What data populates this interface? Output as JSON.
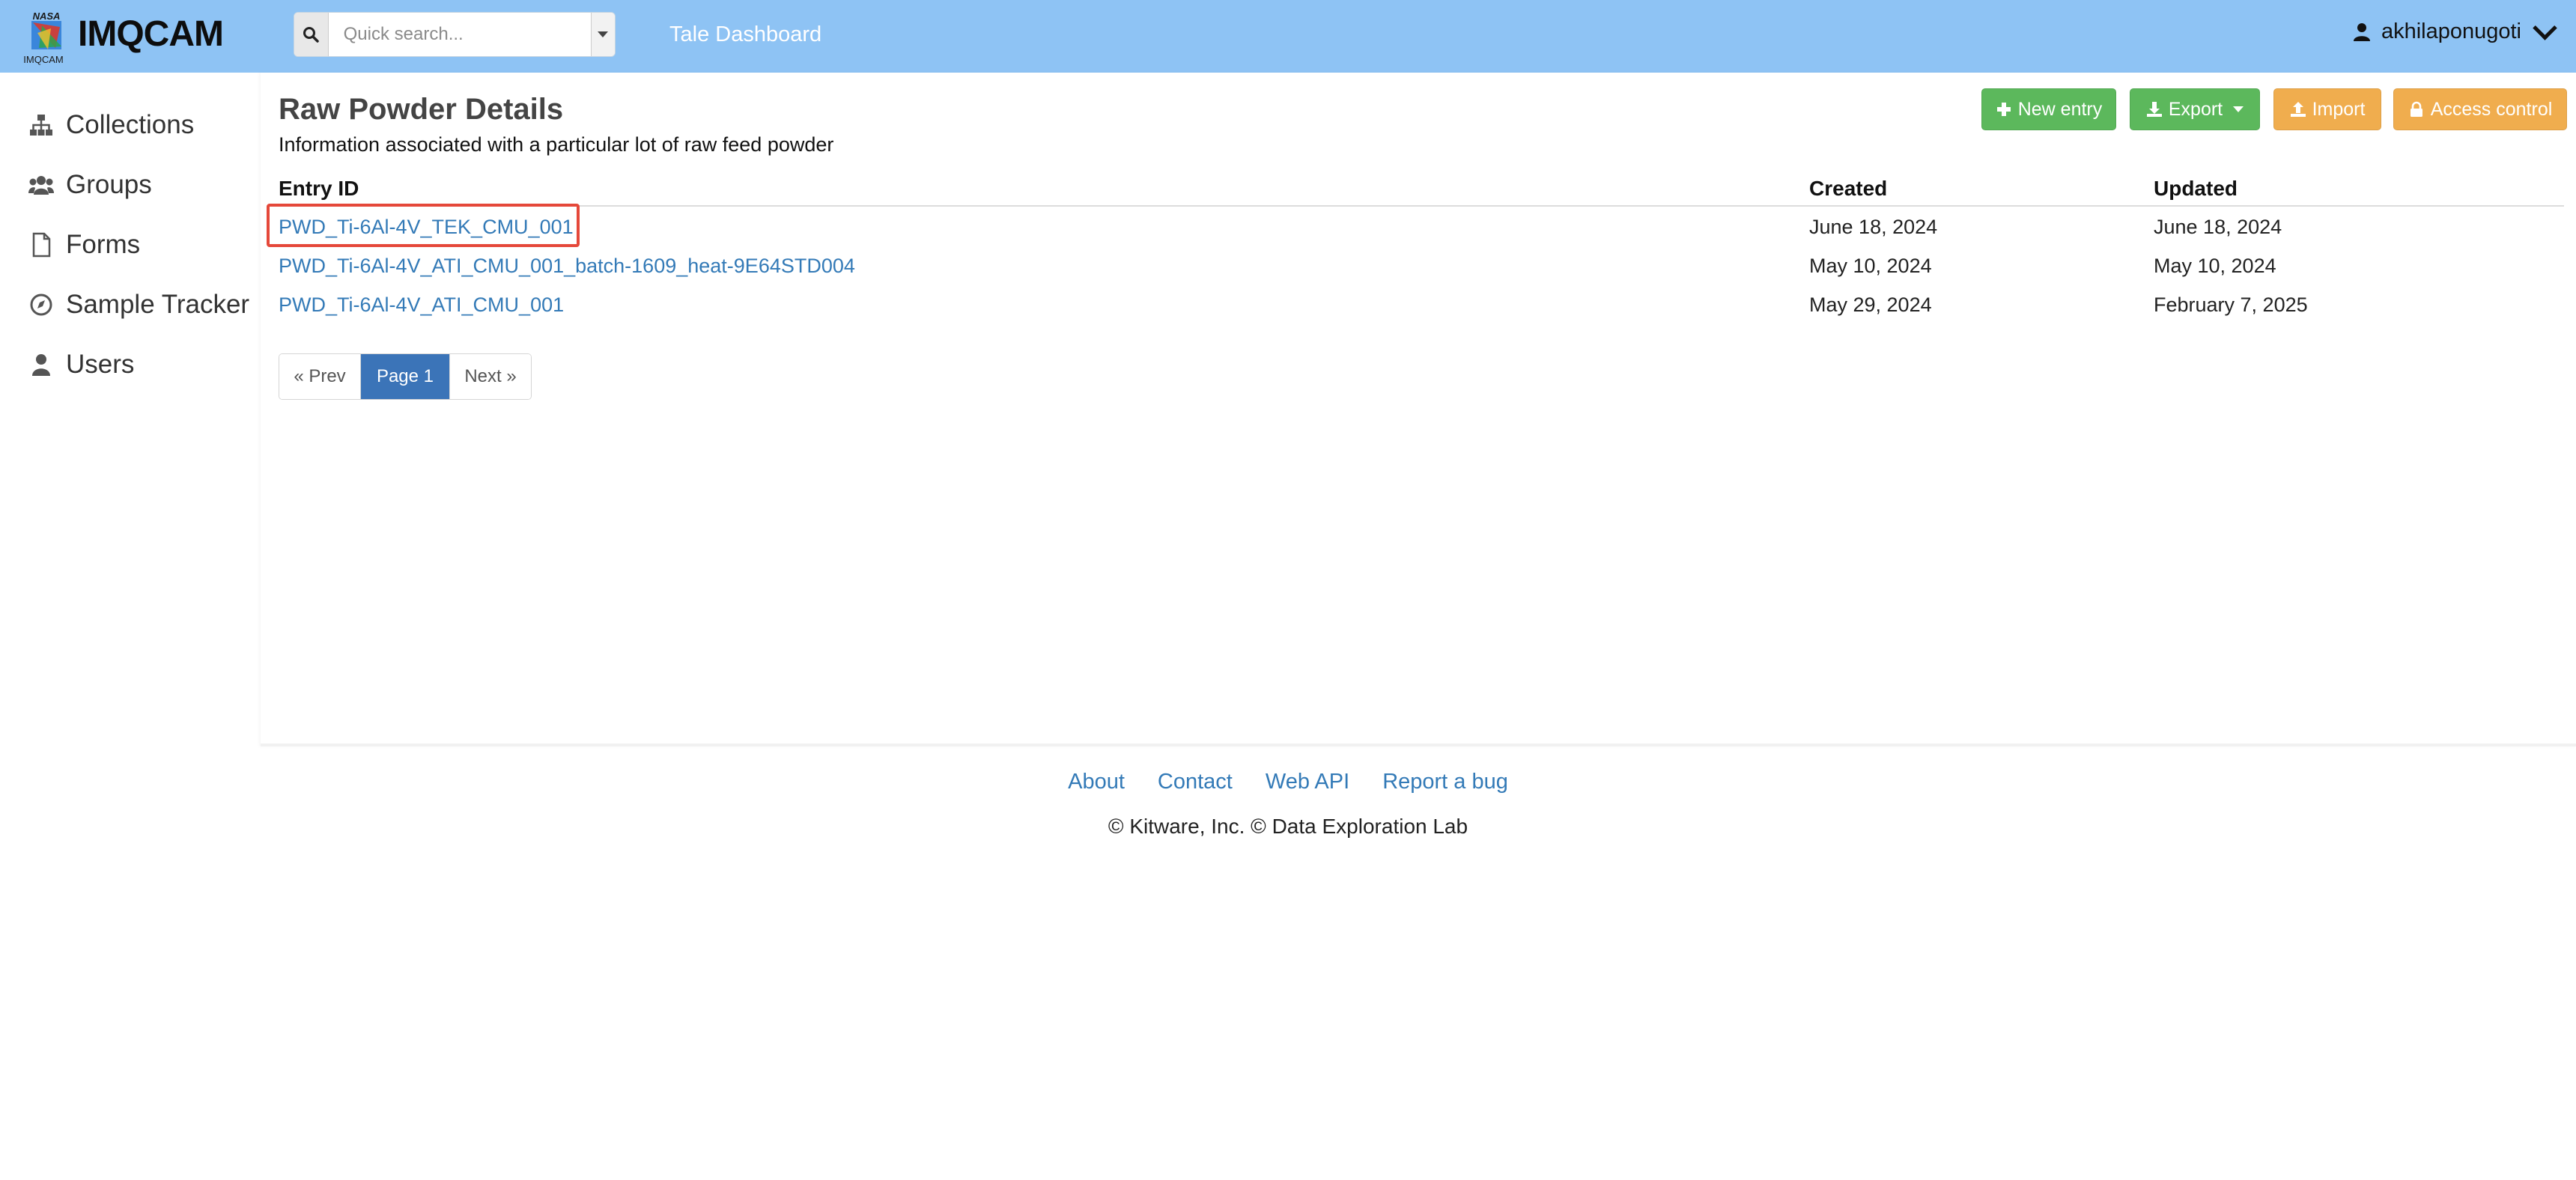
{
  "header": {
    "logo_top_text": "NASA",
    "logo_bottom_text": "IMQCAM",
    "brand": "IMQCAM",
    "search_placeholder": "Quick search...",
    "dashboard_link": "Tale Dashboard",
    "username": "akhilaponugoti"
  },
  "sidebar": {
    "items": [
      {
        "label": "Collections",
        "icon": "sitemap-icon"
      },
      {
        "label": "Groups",
        "icon": "users-icon"
      },
      {
        "label": "Forms",
        "icon": "file-icon"
      },
      {
        "label": "Sample Tracker",
        "icon": "compass-icon"
      },
      {
        "label": "Users",
        "icon": "user-icon"
      }
    ]
  },
  "main": {
    "title": "Raw Powder Details",
    "description": "Information associated with a particular lot of raw feed powder",
    "toolbar": {
      "new_entry": "New entry",
      "export": "Export",
      "import": "Import",
      "access_control": "Access control"
    },
    "table": {
      "headers": [
        "Entry ID",
        "Created",
        "Updated"
      ],
      "rows": [
        {
          "id": "PWD_Ti-6Al-4V_TEK_CMU_001",
          "created": "June 18, 2024",
          "updated": "June 18, 2024"
        },
        {
          "id": "PWD_Ti-6Al-4V_ATI_CMU_001_batch-1609_heat-9E64STD004",
          "created": "May 10, 2024",
          "updated": "May 10, 2024"
        },
        {
          "id": "PWD_Ti-6Al-4V_ATI_CMU_001",
          "created": "May 29, 2024",
          "updated": "February 7, 2025"
        }
      ]
    },
    "pagination": {
      "prev": "« Prev",
      "current": "Page 1",
      "next": "Next »"
    }
  },
  "footer": {
    "links": [
      "About",
      "Contact",
      "Web API",
      "Report a bug"
    ],
    "copyright": "© Kitware, Inc. © Data Exploration Lab"
  },
  "colors": {
    "header_bg": "#8ec3f4",
    "link": "#337ab7",
    "success": "#5cb85c",
    "warning": "#f0ad4e",
    "highlight": "#e5483a",
    "active_page": "#3b74b8"
  }
}
